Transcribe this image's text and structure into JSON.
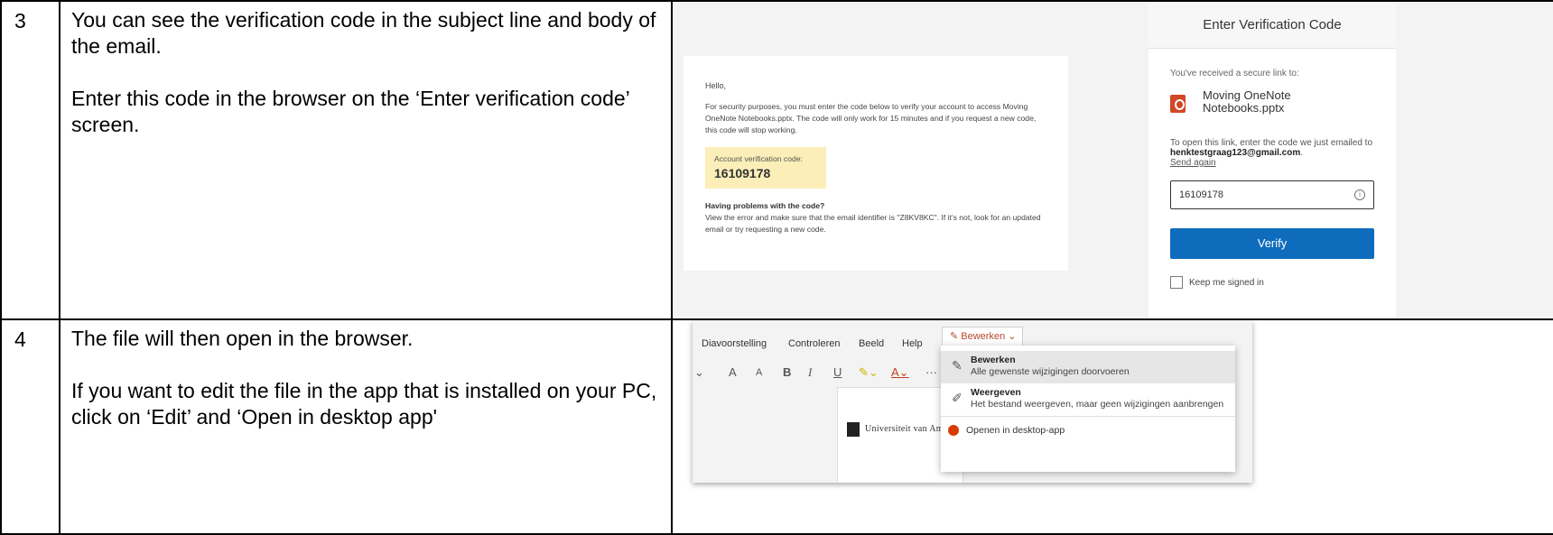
{
  "steps": [
    {
      "number": "3",
      "paragraphs": [
        "You can see the verification code in the subject line and body of the email.",
        "Enter this code in the browser on the ‘Enter verification code’ screen."
      ]
    },
    {
      "number": "4",
      "paragraphs": [
        "The file will then open in the browser.",
        "If you want to edit the file in the app that is installed on your PC, click on ‘Edit’ and ‘Open in desktop app'"
      ]
    }
  ],
  "email": {
    "greeting": "Hello,",
    "body": "For security purposes, you must enter the code below to verify your account to access Moving OneNote Notebooks.pptx. The code will only work for 15 minutes and if you request a new code, this code will stop working.",
    "code_label": "Account verification code:",
    "code_value": "16109178",
    "problems_heading": "Having problems with the code?",
    "problems_text": "View the error and make sure that the email identifier is \"Z8KV8KC\". If it's not, look for an updated email or try requesting a new code."
  },
  "verify_panel": {
    "title": "Enter Verification Code",
    "received": "You've received a secure link to:",
    "file_name": "Moving OneNote Notebooks.pptx",
    "open_text": "To open this link, enter the code we just emailed to ",
    "email_address": "henktestgraag123@gmail.com",
    "period": ".",
    "send_again": "Send again",
    "code_input_value": "16109178",
    "verify_label": "Verify",
    "keep_signed_in": "Keep me signed in"
  },
  "app": {
    "menu": [
      "Diavoorstelling",
      "Controleren",
      "Beeld",
      "Help"
    ],
    "edit_menu_label": "Bewerken",
    "more": "···",
    "dropdown": [
      {
        "title": "Bewerken",
        "desc": "Alle gewenste wijzigingen doorvoeren",
        "icon": "pencil-icon"
      },
      {
        "title": "Weergeven",
        "desc": "Het bestand weergeven, maar geen wijzigingen aanbrengen",
        "icon": "view-pen-icon"
      }
    ],
    "open_desktop": "Openen in desktop-app",
    "doc_header": "Universiteit van Amst"
  },
  "colors": {
    "verify_button": "#0f6cbd",
    "code_highlight": "#fbeeb8",
    "ppt_red": "#d24726",
    "edit_accent": "#b7472a"
  }
}
